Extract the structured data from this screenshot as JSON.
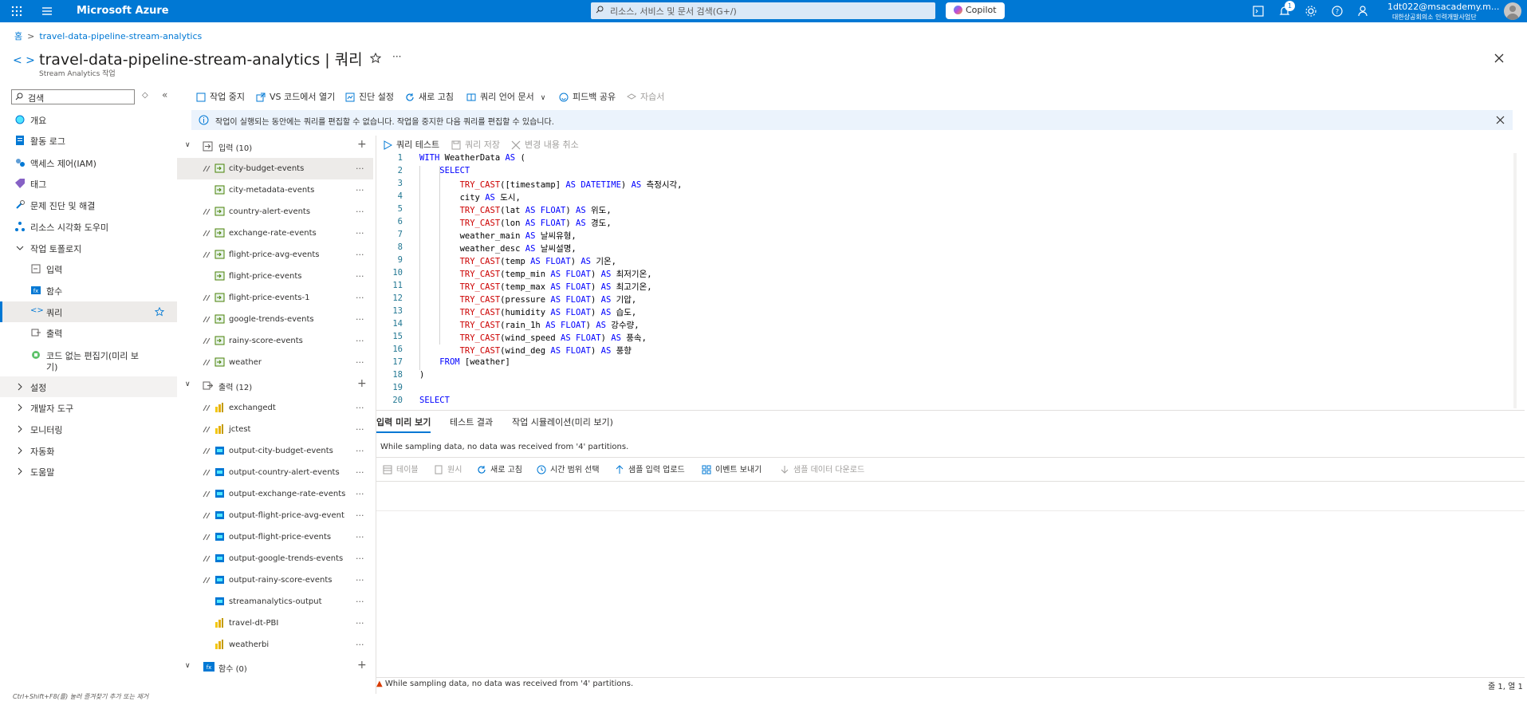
{
  "topbar": {
    "brand": "Microsoft Azure",
    "search_placeholder": "리소스, 서비스 및 문서 검색(G+/)",
    "copilot": "Copilot",
    "notification_count": "1",
    "user_email": "1dt022@msacademy.m...",
    "user_org": "대한상공회의소 인력개발사업단",
    "accent": "#0078d4"
  },
  "breadcrumb": {
    "home": "홈",
    "resource": "travel-data-pipeline-stream-analytics"
  },
  "page": {
    "title": "travel-data-pipeline-stream-analytics | 쿼리",
    "subtitle": "Stream Analytics 작업"
  },
  "sidebar": {
    "search_placeholder": "검색",
    "items": [
      {
        "label": "개요",
        "icon": "overview-icon"
      },
      {
        "label": "활동 로그",
        "icon": "activity-log-icon"
      },
      {
        "label": "액세스 제어(IAM)",
        "icon": "iam-icon"
      },
      {
        "label": "태그",
        "icon": "tag-icon"
      },
      {
        "label": "문제 진단 및 해결",
        "icon": "diagnose-icon"
      },
      {
        "label": "리소스 시각화 도우미",
        "icon": "visualizer-icon"
      },
      {
        "label": "작업 토폴로지",
        "icon": "chevron-down-icon"
      },
      {
        "label": "입력",
        "icon": "input-icon"
      },
      {
        "label": "함수",
        "icon": "function-icon"
      },
      {
        "label": "쿼리",
        "icon": "query-icon"
      },
      {
        "label": "출력",
        "icon": "output-icon"
      },
      {
        "label": "코드 없는 편집기(미리 보",
        "label2": "기)",
        "icon": "no-code-icon"
      },
      {
        "label": "설정",
        "icon": "chevron-right-icon"
      },
      {
        "label": "개발자 도구",
        "icon": "chevron-right-icon"
      },
      {
        "label": "모니터링",
        "icon": "chevron-right-icon"
      },
      {
        "label": "자동화",
        "icon": "chevron-right-icon"
      },
      {
        "label": "도움말",
        "icon": "chevron-right-icon"
      }
    ],
    "hint": "Ctrl+Shift+F8(를) 눌러 즐겨찾기 추가 또는 제거"
  },
  "toolbar": {
    "stop": "작업 중지",
    "vscode": "VS 코드에서 열기",
    "diagnostics": "진단 설정",
    "refresh": "새로 고침",
    "docs": "쿼리 언어 문서",
    "feedback": "피드백 공유",
    "tutorial": "자습서"
  },
  "info_message": "작업이 실행되는 동안에는 쿼리를 편집할 수 없습니다. 작업을 중지한 다음 쿼리를 편집할 수 있습니다.",
  "tree": {
    "inputs_label": "입력 (10)",
    "inputs": [
      "city-budget-events",
      "city-metadata-events",
      "country-alert-events",
      "exchange-rate-events",
      "flight-price-avg-events",
      "flight-price-events",
      "flight-price-events-1",
      "google-trends-events",
      "rainy-score-events",
      "weather"
    ],
    "outputs_label": "출력 (12)",
    "outputs": [
      "exchangedt",
      "jctest",
      "output-city-budget-events",
      "output-country-alert-events",
      "output-exchange-rate-events",
      "output-flight-price-avg-event",
      "output-flight-price-events",
      "output-google-trends-events",
      "output-rainy-score-events",
      "streamanalytics-output",
      "travel-dt-PBI",
      "weatherbi"
    ],
    "functions_label": "함수 (0)"
  },
  "editor_toolbar": {
    "test": "쿼리 테스트",
    "save": "쿼리 저장",
    "discard": "변경 내용 취소"
  },
  "code_lines": [
    "WITH WeatherData AS (",
    "    SELECT",
    "        TRY_CAST([timestamp] AS DATETIME) AS 측정시각,",
    "        city AS 도시,",
    "        TRY_CAST(lat AS FLOAT) AS 위도,",
    "        TRY_CAST(lon AS FLOAT) AS 경도,",
    "        weather_main AS 날씨유형,",
    "        weather_desc AS 날씨설명,",
    "        TRY_CAST(temp AS FLOAT) AS 기온,",
    "        TRY_CAST(temp_min AS FLOAT) AS 최저기온,",
    "        TRY_CAST(temp_max AS FLOAT) AS 최고기온,",
    "        TRY_CAST(pressure AS FLOAT) AS 기압,",
    "        TRY_CAST(humidity AS FLOAT) AS 습도,",
    "        TRY_CAST(rain_1h AS FLOAT) AS 강수량,",
    "        TRY_CAST(wind_speed AS FLOAT) AS 풍속,",
    "        TRY_CAST(wind_deg AS FLOAT) AS 풍향",
    "    FROM [weather]",
    ")",
    "",
    "SELECT"
  ],
  "bottom": {
    "tabs": [
      "입력 미리 보기",
      "테스트 결과",
      "작업 시뮬레이션(미리 보기)"
    ],
    "message": "While sampling data, no data was received from '4' partitions.",
    "toolbar": [
      "테이블",
      "원시",
      "새로 고침",
      "시간 범위 선택",
      "샘플 입력 업로드",
      "이벤트 보내기",
      "샘플 데이터 다운로드"
    ],
    "status": "While sampling data, no data was received from '4' partitions.",
    "position": "줄 1, 열 1"
  }
}
